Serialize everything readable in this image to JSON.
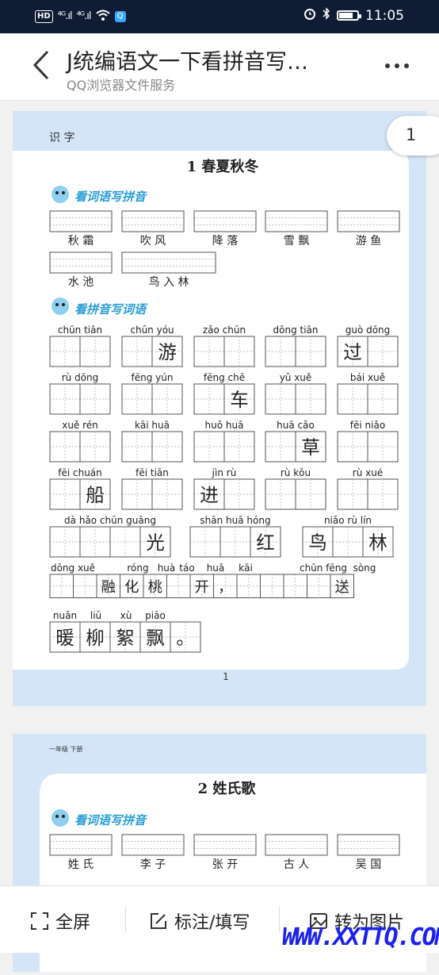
{
  "status_bar": {
    "hd": "HD",
    "signal1": "⁴ᴳ.ıl",
    "signal2": "⁴ᴳ.ıl",
    "time": "11:05"
  },
  "header": {
    "title": "J统编语文一下看拼音写…",
    "subtitle": "QQ浏览器文件服务"
  },
  "page_badge": "1",
  "page1": {
    "section_label": "识 字",
    "lesson_title": "1 春夏秋冬",
    "heading1": "看词语写拼音",
    "words1": [
      "秋 霜",
      "吹 风",
      "降 落",
      "雪 飘",
      "游 鱼",
      "水 池",
      "鸟 入 林"
    ],
    "heading2": "看拼音写词语",
    "rows": [
      [
        {
          "py": "chūn tiān",
          "chars": [
            "",
            ""
          ]
        },
        {
          "py": "chūn yóu",
          "chars": [
            "",
            "游"
          ]
        },
        {
          "py": "zǎo chūn",
          "chars": [
            "",
            ""
          ]
        },
        {
          "py": "dōng tiān",
          "chars": [
            "",
            ""
          ]
        },
        {
          "py": "guò dōng",
          "chars": [
            "过",
            ""
          ]
        }
      ],
      [
        {
          "py": "rù dōng",
          "chars": [
            "",
            ""
          ]
        },
        {
          "py": "fēng yún",
          "chars": [
            "",
            ""
          ]
        },
        {
          "py": "fēng chē",
          "chars": [
            "",
            "车"
          ]
        },
        {
          "py": "yǔ xuě",
          "chars": [
            "",
            ""
          ]
        },
        {
          "py": "bái xuě",
          "chars": [
            "",
            ""
          ]
        }
      ],
      [
        {
          "py": "xuě rén",
          "chars": [
            "",
            ""
          ]
        },
        {
          "py": "kāi huā",
          "chars": [
            "",
            ""
          ]
        },
        {
          "py": "huǒ huā",
          "chars": [
            "",
            ""
          ]
        },
        {
          "py": "huā cǎo",
          "chars": [
            "",
            "草"
          ]
        },
        {
          "py": "fēi niǎo",
          "chars": [
            "",
            ""
          ]
        }
      ],
      [
        {
          "py": "fēi chuán",
          "chars": [
            "",
            "船"
          ]
        },
        {
          "py": "fēi tiān",
          "chars": [
            "",
            ""
          ]
        },
        {
          "py": "jìn rù",
          "chars": [
            "进",
            ""
          ]
        },
        {
          "py": "rù kǒu",
          "chars": [
            "",
            ""
          ]
        },
        {
          "py": "rù xué",
          "chars": [
            "",
            ""
          ]
        }
      ]
    ],
    "row5": [
      {
        "py": "dà hǎo chūn guāng",
        "chars": [
          "",
          "",
          "",
          "光"
        ]
      },
      {
        "py": "shān huā hóng",
        "chars": [
          "",
          "",
          "红"
        ]
      },
      {
        "py": "niǎo rù lín",
        "chars": [
          "鸟",
          "",
          "林"
        ]
      }
    ],
    "row6_py": [
      "dōng xuě",
      "róng",
      "huà",
      "táo",
      "huā",
      "kāi",
      "chūn fēng",
      "sòng"
    ],
    "row6_chars": [
      "",
      "",
      "融",
      "化",
      "桃",
      "",
      "开",
      "，",
      "",
      "",
      "",
      "",
      "送"
    ],
    "row7_py": [
      "nuǎn",
      "liǔ",
      "xù",
      "piāo"
    ],
    "row7_chars": [
      "暖",
      "柳",
      "絮",
      "飘",
      "。"
    ],
    "page_number": "1"
  },
  "page2": {
    "grade_label": "一年级 下册",
    "lesson_title": "2 姓氏歌",
    "heading1": "看词语写拼音",
    "words1": [
      "姓 氏",
      "李 子",
      "张 开",
      "古 人",
      "吴 国"
    ]
  },
  "bottom": {
    "fullscreen": "全屏",
    "annotate": "标注/填写",
    "to_image": "转为图片"
  },
  "watermark": "WWW.XXTTQ.COM",
  "colors": {
    "statusbar": "#0f1c33",
    "page_bg": "#d3e5f7",
    "grid_line": "#555555",
    "heading": "#2a9ed8"
  }
}
